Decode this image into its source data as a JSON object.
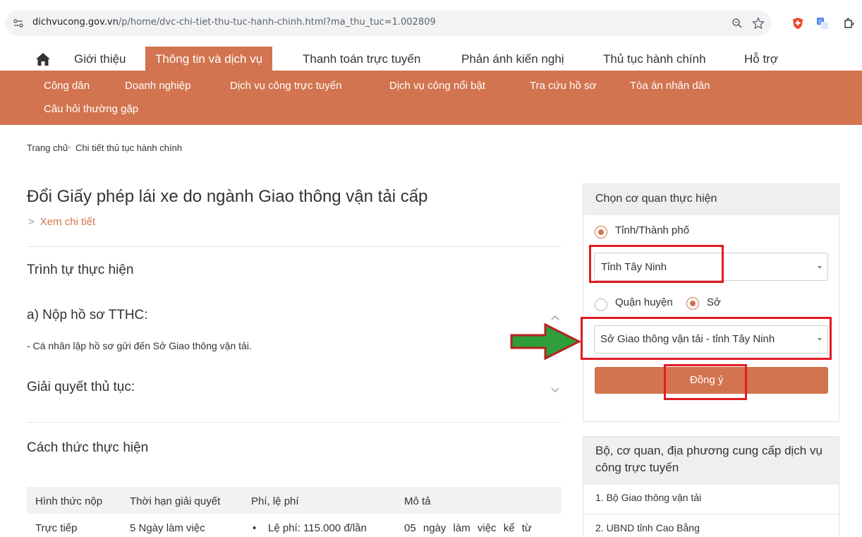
{
  "browser": {
    "url_host": "dichvucong.gov.vn",
    "url_path": "/p/home/dvc-chi-tiet-thu-tuc-hanh-chinh.html?ma_thu_tuc=1.002809",
    "icons": [
      "site-info-icon",
      "zoom-icon",
      "bookmark-star-icon",
      "shield-extension-icon",
      "translate-extension-icon",
      "extensions-icon"
    ]
  },
  "nav": {
    "items": [
      "Giới thiệu",
      "Thông tin và dịch vụ",
      "Thanh toán trực tuyến",
      "Phản ánh kiến nghị",
      "Thủ tục hành chính",
      "Hỗ trợ"
    ],
    "active_index": 1
  },
  "subnav": {
    "items": [
      "Công dân",
      "Doanh nghiệp",
      "Dịch vụ công trực tuyến",
      "Dịch vụ công nổi bật",
      "Tra cứu hồ sơ",
      "Tòa án nhân dân",
      "Câu hỏi thường gặp"
    ]
  },
  "breadcrumb": {
    "home": "Trang chủ",
    "separator": ">",
    "current": "Chi tiết thủ tục hành chính"
  },
  "main": {
    "title": "Đổi Giấy phép lái xe do ngành Giao thông vận tải cấp",
    "view_detail": "Xem chi tiết",
    "view_detail_prefix": ">",
    "section_sequence": "Trình tự thực hiện",
    "step_a_title": "a) Nộp hồ sơ TTHC:",
    "step_a_text": "- Cá nhân lập hồ sơ gửi đến Sở Giao thông vận tải.",
    "step_resolve_title": "Giải quyết thủ tục:",
    "section_method": "Cách thức thực hiện",
    "table": {
      "headers": [
        "Hình thức nộp",
        "Thời hạn giải quyết",
        "Phí, lệ phí",
        "Mô tả"
      ],
      "row1": [
        "Trực tiếp",
        "5 Ngày làm việc",
        "Lệ phí: 115.000 đ/lần",
        "05 ngày làm việc kể từ"
      ],
      "bullet": "•"
    }
  },
  "agency_panel": {
    "title": "Chọn cơ quan thực hiện",
    "radio_province": "Tỉnh/Thành phố",
    "province_value": "Tỉnh Tây Ninh",
    "radio_district": "Quận huyện",
    "radio_department": "Sở",
    "department_value": "Sở Giao thông vận tải - tỉnh Tây Ninh",
    "submit": "Đồng ý",
    "highlight_color": "#e21b24",
    "arrow_color": "#2e9e3a"
  },
  "provider_panel": {
    "title": "Bộ, cơ quan, địa phương cung cấp dịch vụ công trực tuyến",
    "items": [
      "1. Bộ Giao thông vận tải",
      "2. UBND tỉnh Cao Bằng"
    ]
  },
  "colors": {
    "accent": "#d2744f"
  }
}
